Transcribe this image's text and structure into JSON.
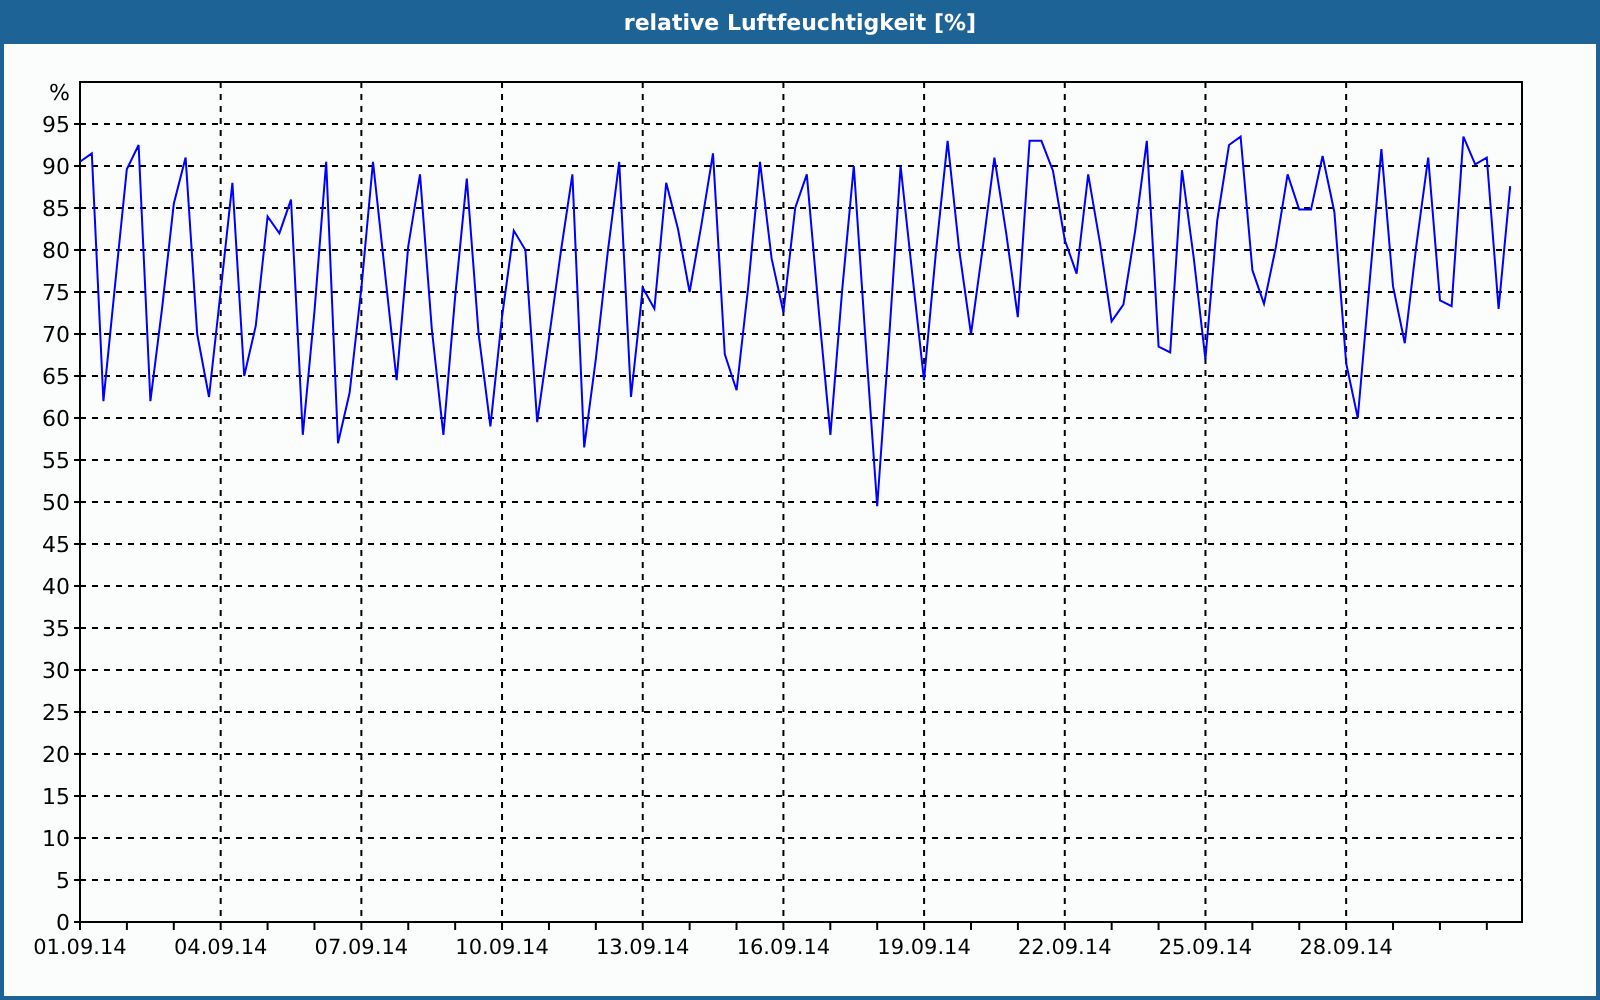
{
  "window": {
    "title": "relative Luftfeuchtigkeit [%]"
  },
  "chart_data": {
    "type": "line",
    "grid": true,
    "ylabel": "%",
    "ylim": [
      0,
      100
    ],
    "yticks": [
      0,
      5,
      10,
      15,
      20,
      25,
      30,
      35,
      40,
      45,
      50,
      55,
      60,
      65,
      70,
      75,
      80,
      85,
      90,
      95
    ],
    "categories": [
      "01.09.14",
      null,
      null,
      null,
      null,
      null,
      null,
      null,
      null,
      null,
      null,
      null,
      "04.09.14",
      null,
      null,
      null,
      null,
      null,
      null,
      null,
      null,
      null,
      null,
      null,
      "07.09.14",
      null,
      null,
      null,
      null,
      null,
      null,
      null,
      null,
      null,
      null,
      null,
      "10.09.14",
      null,
      null,
      null,
      null,
      null,
      null,
      null,
      null,
      null,
      null,
      null,
      "13.09.14",
      null,
      null,
      null,
      null,
      null,
      null,
      null,
      null,
      null,
      null,
      null,
      "16.09.14",
      null,
      null,
      null,
      null,
      null,
      null,
      null,
      null,
      null,
      null,
      null,
      "19.09.14",
      null,
      null,
      null,
      null,
      null,
      null,
      null,
      null,
      null,
      null,
      null,
      "22.09.14",
      null,
      null,
      null,
      null,
      null,
      null,
      null,
      null,
      null,
      null,
      null,
      "25.09.14",
      null,
      null,
      null,
      null,
      null,
      null,
      null,
      null,
      null,
      null,
      null,
      "28.09.14",
      null,
      null,
      null,
      null,
      null,
      null,
      null,
      null,
      null,
      null,
      null,
      null,
      null,
      null
    ],
    "series": [
      {
        "color": "#0000ff",
        "values": [
          90.5,
          91.5,
          62,
          76,
          89.6,
          92.5,
          62,
          73,
          85.5,
          91,
          70,
          62.5,
          75,
          88,
          65,
          71,
          84,
          82,
          86,
          58,
          72.6,
          90.5,
          57,
          63,
          75.5,
          90.5,
          77.5,
          64.5,
          80.4,
          89,
          70.6,
          58,
          74.5,
          88.5,
          70,
          59,
          72,
          82.3,
          80,
          59.5,
          69.5,
          79.6,
          89,
          56.5,
          67,
          79.6,
          90.5,
          62.5,
          75.5,
          73,
          88,
          82.5,
          75,
          83,
          91.5,
          67.6,
          63.3,
          75.6,
          90.5,
          79,
          72.6,
          85,
          89,
          73,
          58,
          75,
          90,
          69.5,
          49.5,
          69.3,
          90,
          77,
          64.5,
          79.6,
          93,
          80,
          70,
          80.3,
          91,
          82,
          72,
          93,
          93,
          89.4,
          81.2,
          77.2,
          89,
          80.8,
          71.5,
          73.5,
          82.3,
          93,
          68.5,
          67.8,
          89.5,
          79,
          67,
          83.5,
          92.5,
          93.5,
          77.6,
          73.6,
          80.3,
          89,
          84.8,
          84.8,
          91.2,
          84.5,
          66.5,
          60,
          76.2,
          92,
          75.7,
          68.9,
          80.6,
          91,
          74,
          73.3,
          93.5,
          90.2,
          91,
          73,
          87.6
        ]
      }
    ]
  }
}
